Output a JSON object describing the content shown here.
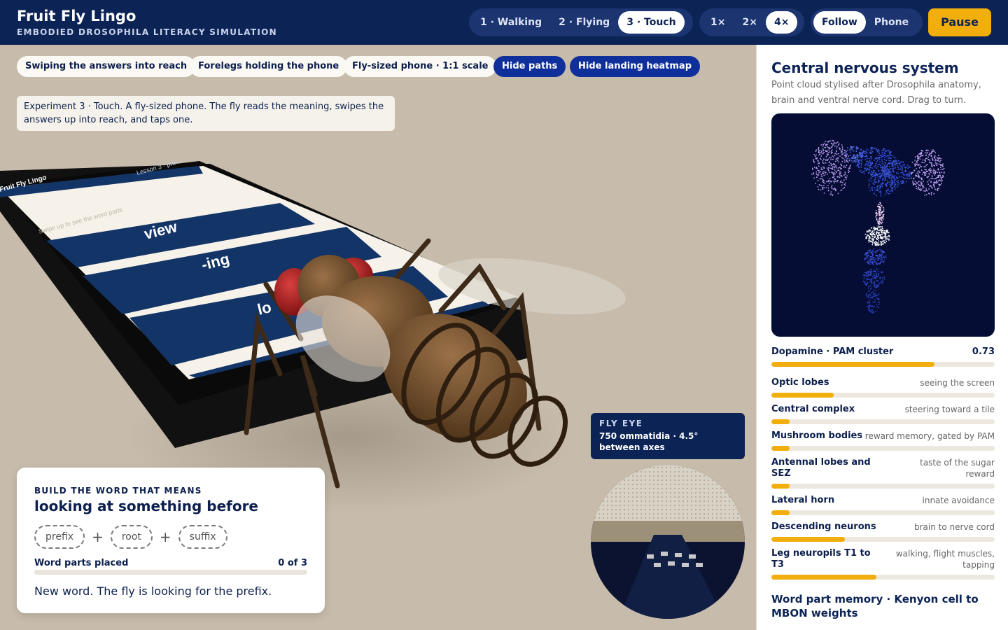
{
  "header": {
    "title": "Fruit Fly Lingo",
    "subtitle": "EMBODIED DROSOPHILA LITERACY SIMULATION",
    "experiments": [
      {
        "label": "1 · Walking",
        "active": false
      },
      {
        "label": "2 · Flying",
        "active": false
      },
      {
        "label": "3 · Touch",
        "active": true
      }
    ],
    "speeds": [
      {
        "label": "1×",
        "active": false
      },
      {
        "label": "2×",
        "active": false
      },
      {
        "label": "4×",
        "active": true
      }
    ],
    "camera": [
      {
        "label": "Follow",
        "active": true
      },
      {
        "label": "Phone",
        "active": false
      }
    ],
    "pause_label": "Pause"
  },
  "scene": {
    "chips": [
      {
        "label": "Swiping the answers into reach",
        "style": "light"
      },
      {
        "label": "Forelegs holding the phone",
        "style": "light"
      },
      {
        "label": "Fly-sized phone · 1:1 scale",
        "style": "light"
      },
      {
        "label": "Hide paths",
        "style": "dark"
      },
      {
        "label": "Hide landing heatmap",
        "style": "dark"
      }
    ],
    "caption": "Experiment 3 · Touch. A fly-sized phone. The fly reads the meaning, swipes the answers up into reach, and taps one.",
    "phone": {
      "app_title": "Fruit Fly Lingo",
      "lesson": "Lesson 3 · pre-",
      "hint": "Swipe up to see the word parts",
      "tiles": [
        "view",
        "-ing",
        "lo"
      ]
    }
  },
  "word_panel": {
    "label": "BUILD THE WORD THAT MEANS",
    "meaning": "looking at something before",
    "slots": [
      "prefix",
      "root",
      "suffix"
    ],
    "plus": "+",
    "progress_label": "Word parts placed",
    "progress_value": "0 of 3",
    "progress_fraction": 0,
    "status": "New word. The fly is looking for the prefix."
  },
  "fly_eye": {
    "title": "FLY EYE",
    "description": "750 ommatidia · 4.5° between axes"
  },
  "side": {
    "title": "Central nervous system",
    "description": "Point cloud stylised after Drosophila anatomy, brain and ventral nerve cord. Drag to turn.",
    "regions": [
      {
        "name": "Dopamine · PAM cluster",
        "note": "0.73",
        "level": 0.73,
        "is_value": true
      },
      {
        "name": "Optic lobes",
        "note": "seeing the screen",
        "level": 0.28
      },
      {
        "name": "Central complex",
        "note": "steering toward a tile",
        "level": 0.08
      },
      {
        "name": "Mushroom bodies",
        "note": "reward memory, gated by PAM",
        "level": 0.08
      },
      {
        "name": "Antennal lobes and SEZ",
        "note": "taste of the sugar reward",
        "level": 0.08
      },
      {
        "name": "Lateral horn",
        "note": "innate avoidance",
        "level": 0.08
      },
      {
        "name": "Descending neurons",
        "note": "brain to nerve cord",
        "level": 0.33
      },
      {
        "name": "Leg neuropils T1 to T3",
        "note": "walking, flight muscles, tapping",
        "level": 0.47
      }
    ],
    "memory_title": "Word part memory · Kenyon cell to MBON weights"
  },
  "colors": {
    "navy": "#0c2355",
    "accent": "#f1ae0c",
    "scene_bg": "#c7bcab",
    "tile_blue": "#133466",
    "fly_brown": "#6b4a2b",
    "eye_red": "#b02020"
  }
}
